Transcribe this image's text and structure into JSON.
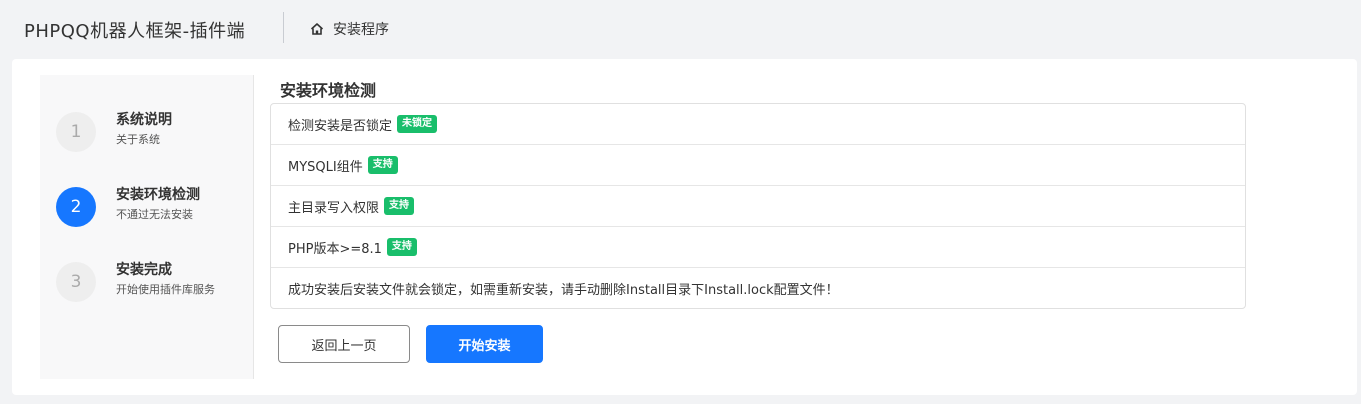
{
  "header": {
    "app_title": "PHPQQ机器人框架-插件端",
    "breadcrumb": {
      "label": "安装程序",
      "icon": "home-icon"
    }
  },
  "steps": [
    {
      "number": "1",
      "title": "系统说明",
      "desc": "关于系统",
      "active": false
    },
    {
      "number": "2",
      "title": "安装环境检测",
      "desc": "不通过无法安装",
      "active": true
    },
    {
      "number": "3",
      "title": "安装完成",
      "desc": "开始使用插件库服务",
      "active": false
    }
  ],
  "main": {
    "section_title": "安装环境检测",
    "checks": [
      {
        "label": "检测安装是否锁定",
        "badge": "未锁定"
      },
      {
        "label": "MYSQLI组件",
        "badge": "支持"
      },
      {
        "label": "主目录写入权限",
        "badge": "支持"
      },
      {
        "label": "PHP版本>=8.1",
        "badge": "支持"
      }
    ],
    "note": "成功安装后安装文件就会锁定，如需重新安装，请手动删除Install目录下Install.lock配置文件！",
    "back_button": "返回上一页",
    "start_button": "开始安装"
  },
  "colors": {
    "primary": "#1677ff",
    "success": "#19be6b",
    "background": "#f2f3f5"
  }
}
